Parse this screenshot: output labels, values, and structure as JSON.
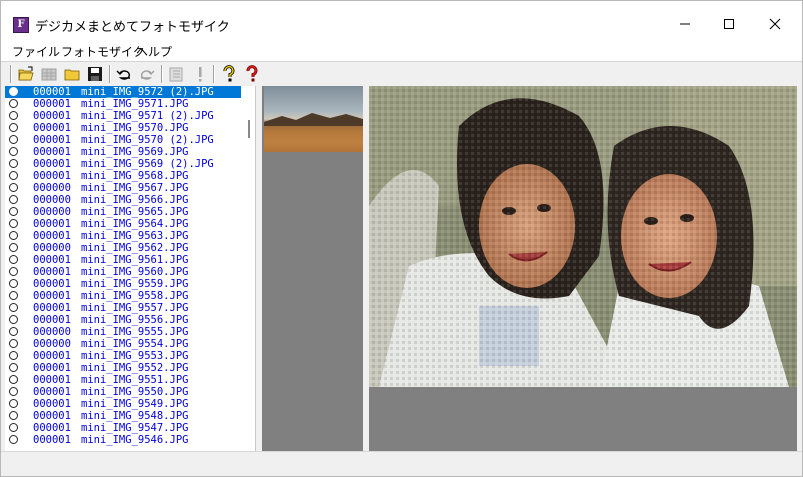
{
  "window": {
    "title": "デジカメまとめてフォトモザイク",
    "icon_letter": "F"
  },
  "menu": [
    "ファイル",
    "フォトモザイク",
    "ヘルプ"
  ],
  "toolbar_icons": [
    "open-folder-icon",
    "grid-disabled-icon",
    "folder-icon",
    "save-icon",
    "undo-icon",
    "redo-disabled-icon",
    "list-disabled-icon",
    "exclamation-disabled-icon",
    "help-icon",
    "help-context-icon"
  ],
  "files": [
    {
      "count": "000001",
      "name": "mini_IMG_9572 (2).JPG",
      "selected": true
    },
    {
      "count": "000001",
      "name": "mini_IMG_9571.JPG"
    },
    {
      "count": "000001",
      "name": "mini_IMG_9571 (2).JPG"
    },
    {
      "count": "000001",
      "name": "mini_IMG_9570.JPG"
    },
    {
      "count": "000001",
      "name": "mini_IMG_9570 (2).JPG"
    },
    {
      "count": "000001",
      "name": "mini_IMG_9569.JPG"
    },
    {
      "count": "000001",
      "name": "mini_IMG_9569 (2).JPG"
    },
    {
      "count": "000001",
      "name": "mini_IMG_9568.JPG"
    },
    {
      "count": "000000",
      "name": "mini_IMG_9567.JPG"
    },
    {
      "count": "000000",
      "name": "mini_IMG_9566.JPG"
    },
    {
      "count": "000000",
      "name": "mini_IMG_9565.JPG"
    },
    {
      "count": "000001",
      "name": "mini_IMG_9564.JPG"
    },
    {
      "count": "000001",
      "name": "mini_IMG_9563.JPG"
    },
    {
      "count": "000000",
      "name": "mini_IMG_9562.JPG"
    },
    {
      "count": "000001",
      "name": "mini_IMG_9561.JPG"
    },
    {
      "count": "000001",
      "name": "mini_IMG_9560.JPG"
    },
    {
      "count": "000001",
      "name": "mini_IMG_9559.JPG"
    },
    {
      "count": "000001",
      "name": "mini_IMG_9558.JPG"
    },
    {
      "count": "000001",
      "name": "mini_IMG_9557.JPG"
    },
    {
      "count": "000001",
      "name": "mini_IMG_9556.JPG"
    },
    {
      "count": "000000",
      "name": "mini_IMG_9555.JPG"
    },
    {
      "count": "000000",
      "name": "mini_IMG_9554.JPG"
    },
    {
      "count": "000001",
      "name": "mini_IMG_9553.JPG"
    },
    {
      "count": "000001",
      "name": "mini_IMG_9552.JPG"
    },
    {
      "count": "000001",
      "name": "mini_IMG_9551.JPG"
    },
    {
      "count": "000001",
      "name": "mini_IMG_9550.JPG"
    },
    {
      "count": "000001",
      "name": "mini_IMG_9549.JPG"
    },
    {
      "count": "000001",
      "name": "mini_IMG_9548.JPG"
    },
    {
      "count": "000001",
      "name": "mini_IMG_9547.JPG"
    },
    {
      "count": "000001",
      "name": "mini_IMG_9546.JPG"
    }
  ],
  "colors": {
    "selection": "#0078d7",
    "list_text": "#0000e0",
    "panel_gray": "#808080"
  }
}
